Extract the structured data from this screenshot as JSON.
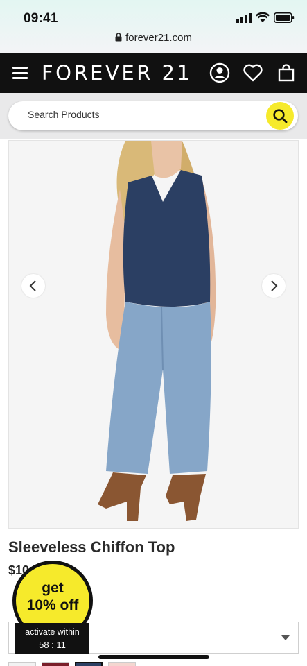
{
  "status_bar": {
    "time": "09:41",
    "url": "forever21.com"
  },
  "nav": {
    "brand": "FOREVER 21"
  },
  "search": {
    "placeholder": "Search Products"
  },
  "product": {
    "title": "Sleeveless Chiffon Top",
    "price_visible": "$10",
    "top_color": "#2b3f63",
    "jeans_color": "#86a6c8"
  },
  "promo": {
    "line1": "get",
    "line2": "10% off",
    "activate_text": "activate within",
    "countdown": "58 : 11"
  },
  "colors": {
    "accent_yellow": "#f6ea2b",
    "nav_bg": "#111111"
  }
}
